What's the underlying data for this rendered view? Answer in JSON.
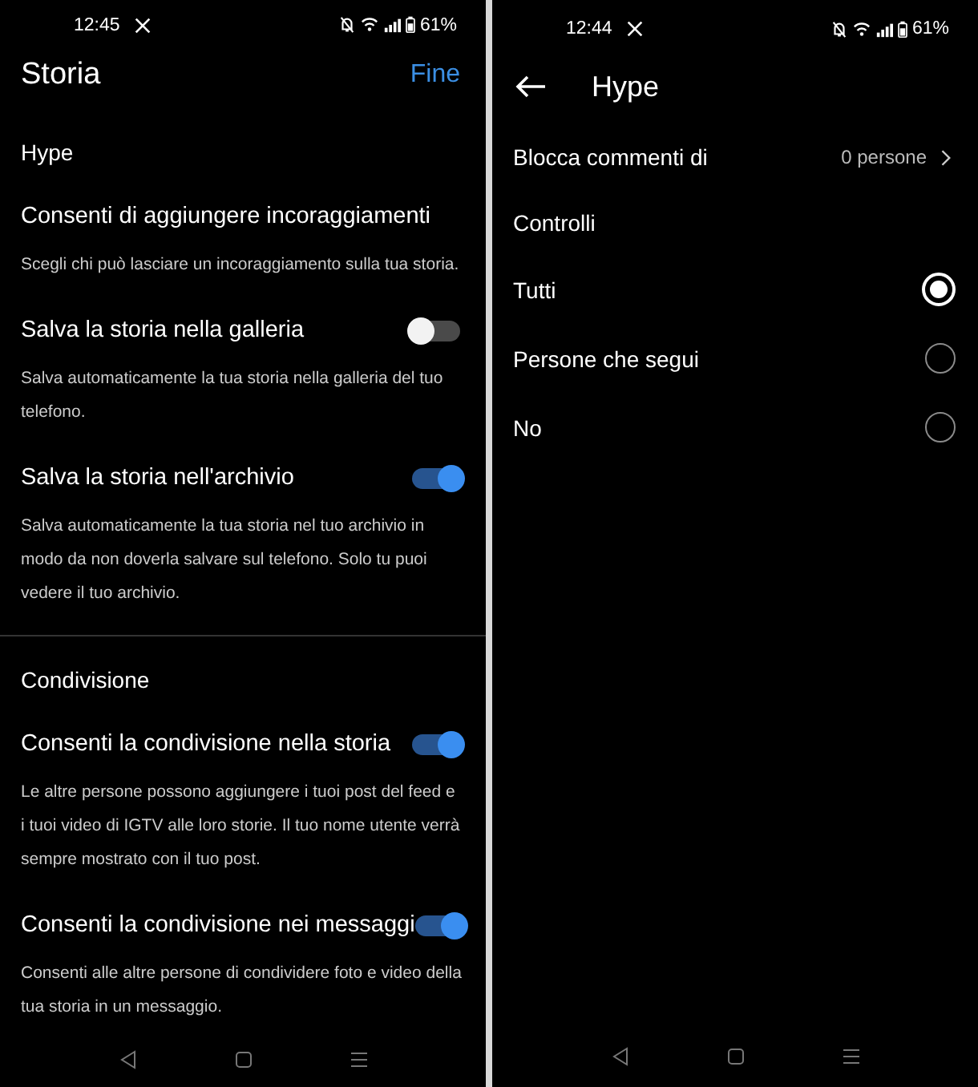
{
  "storia_screen": {
    "status_bar": {
      "time": "12:45",
      "battery": "61%"
    },
    "title": "Storia",
    "done_button": "Fine",
    "sections": [
      {
        "heading": "Hype",
        "items": [
          {
            "kind": "link",
            "title": "Consenti di aggiungere incoraggiamenti",
            "description": "Scegli chi può lasciare un incoraggiamento sulla tua storia."
          },
          {
            "kind": "toggle",
            "title": "Salva la storia nella galleria",
            "description": "Salva automaticamente la tua storia nella galleria del tuo telefono.",
            "on": false
          },
          {
            "kind": "toggle",
            "title": "Salva la storia nell'archivio",
            "description": "Salva automaticamente la tua storia nel tuo archivio in modo da non doverla salvare sul telefono. Solo tu puoi vedere il tuo archivio.",
            "on": true
          }
        ]
      },
      {
        "heading": "Condivisione",
        "items": [
          {
            "kind": "toggle",
            "title": "Consenti la condivisione nella storia",
            "description": "Le altre persone possono aggiungere i tuoi post del feed e i tuoi video di IGTV alle loro storie. Il tuo nome utente verrà sempre mostrato con il tuo post.",
            "on": true
          },
          {
            "kind": "toggle",
            "title": "Consenti la condivisione nei messaggi",
            "description": "Consenti alle altre persone di condividere foto e video della tua storia in un messaggio.",
            "on": true
          }
        ]
      }
    ]
  },
  "hype_screen": {
    "status_bar": {
      "time": "12:44",
      "battery": "61%"
    },
    "title": "Hype",
    "block_row": {
      "label": "Blocca commenti di",
      "value": "0 persone"
    },
    "controls_heading": "Controlli",
    "options": [
      {
        "label": "Tutti",
        "selected": true
      },
      {
        "label": "Persone che segui",
        "selected": false
      },
      {
        "label": "No",
        "selected": false
      }
    ]
  }
}
